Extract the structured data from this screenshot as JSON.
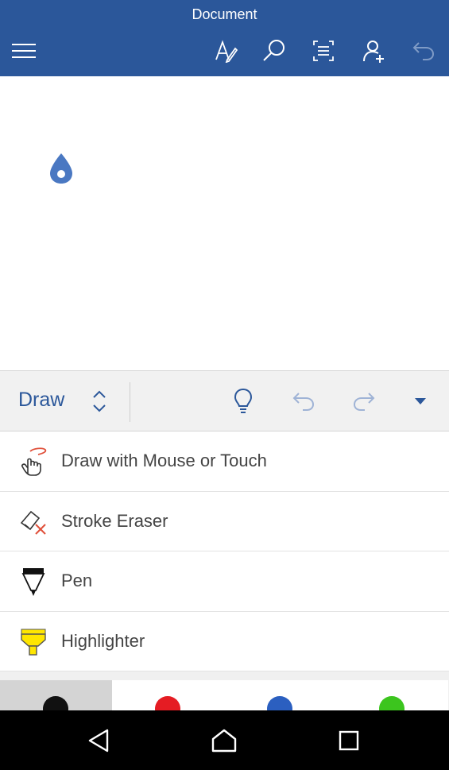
{
  "appbar": {
    "title": "Document",
    "icons": [
      "hamburger-menu-icon",
      "edit-format-icon",
      "search-icon",
      "reading-view-icon",
      "share-person-icon",
      "undo-icon"
    ],
    "color": "#2b579a"
  },
  "ribbon": {
    "tab_label": "Draw",
    "icons": [
      "chevron-updown-icon",
      "lightbulb-icon",
      "undo-icon",
      "redo-icon",
      "dropdown-arrow-icon"
    ],
    "accent": "#2b579a"
  },
  "menu": {
    "items": [
      {
        "label": "Draw with Mouse or Touch",
        "icon": "draw-touch-icon"
      },
      {
        "label": "Stroke Eraser",
        "icon": "stroke-eraser-icon"
      },
      {
        "label": "Pen",
        "icon": "pen-icon"
      },
      {
        "label": "Highlighter",
        "icon": "highlighter-icon"
      }
    ]
  },
  "swatches": {
    "colors": [
      "#111111",
      "#e51c23",
      "#2b5fc0",
      "#3cc51e"
    ],
    "selected_index": 0
  },
  "navbar": {
    "icons": [
      "back-icon",
      "home-icon",
      "recents-icon"
    ]
  }
}
